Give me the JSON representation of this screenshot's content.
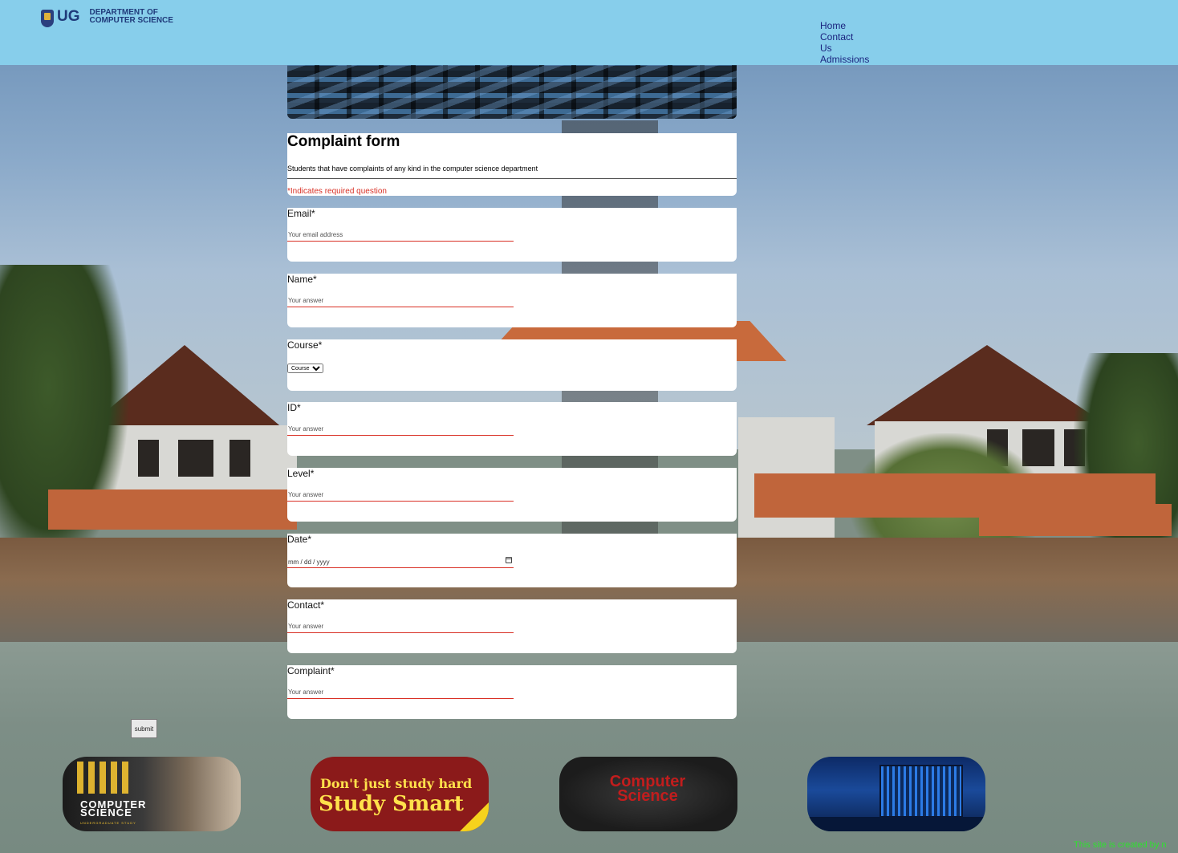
{
  "header": {
    "logo_ug": "UG",
    "logo_line1": "DEPARTMENT OF",
    "logo_line2": "COMPUTER SCIENCE",
    "nav": [
      "Home",
      "Contact",
      "Us",
      "Admissions"
    ]
  },
  "form": {
    "title": "Complaint form",
    "description": "Students that have complaints of any kind in the computer science department",
    "required_note": "*Indicates required question",
    "questions": {
      "email": {
        "label": "Email*",
        "placeholder": "Your email address"
      },
      "name": {
        "label": "Name*",
        "placeholder": "Your answer"
      },
      "course": {
        "label": "Course*",
        "selected": "Course"
      },
      "id": {
        "label": "ID*",
        "placeholder": "Your answer"
      },
      "level": {
        "label": "Level*",
        "placeholder": "Your answer"
      },
      "date": {
        "label": "Date*",
        "placeholder": "mm / dd / yyyy"
      },
      "contact": {
        "label": "Contact*",
        "placeholder": "Your answer"
      },
      "complaint": {
        "label": "Complaint*",
        "placeholder": "Your answer"
      }
    },
    "submit_label": "submit"
  },
  "thumbnails": {
    "t1_title_line1": "COMPUTER",
    "t1_title_line2": "SCIENCE",
    "t1_sub": "UNDERGRADUATE STUDY",
    "t2_line1": "Don't just study hard",
    "t2_line2": "Study Smart",
    "t3_line1": "Computer",
    "t3_line2": "Science"
  },
  "footer": {
    "note": "This site is created by n"
  },
  "colors": {
    "header_bg": "#87ceeb",
    "nav_link": "#1a237e",
    "required": "#d93025",
    "footer_text": "#2fe02f"
  }
}
